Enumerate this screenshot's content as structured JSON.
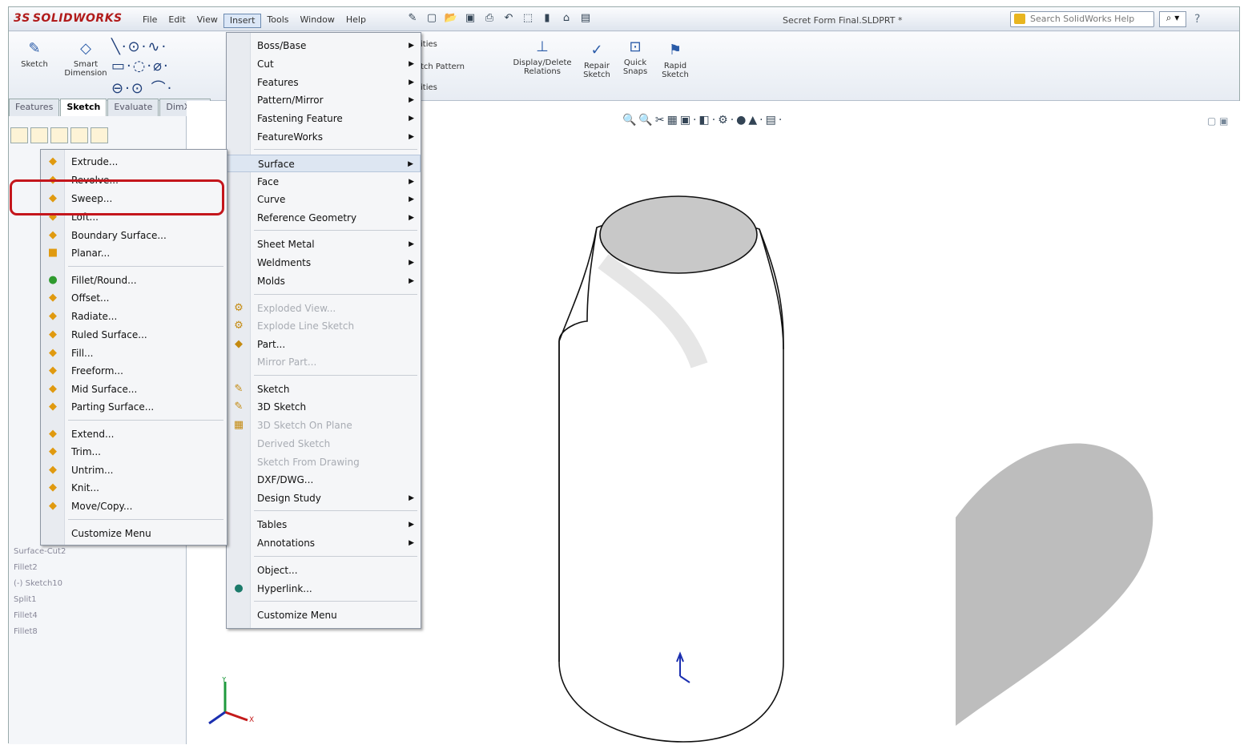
{
  "app": {
    "logo": "SOLIDWORKS",
    "logo_prefix": "3S",
    "document_title": "Secret Form Final.SLDPRT *"
  },
  "menubar": [
    "File",
    "Edit",
    "View",
    "Insert",
    "Tools",
    "Window",
    "Help"
  ],
  "search": {
    "placeholder": "Search SolidWorks Help",
    "button": "⌕ ▾"
  },
  "ribbon": {
    "sketch": "Sketch",
    "smart_dimension_1": "Smart",
    "smart_dimension_2": "Dimension",
    "entities": "ities",
    "sketch_pattern": "tch Pattern",
    "display_delete_1": "Display/Delete",
    "display_delete_2": "Relations",
    "repair_1": "Repair",
    "repair_2": "Sketch",
    "quick_1": "Quick",
    "quick_2": "Snaps",
    "rapid_1": "Rapid",
    "rapid_2": "Sketch",
    "ities": "ities"
  },
  "tabs": [
    "Features",
    "Sketch",
    "Evaluate",
    "DimXper"
  ],
  "tree": [
    "Surface-Cut2",
    "Fillet2",
    "(-) Sketch10",
    "Split1",
    "Fillet4",
    "Fillet8"
  ],
  "insert_menu": [
    {
      "label": "Boss/Base",
      "sub": true
    },
    {
      "label": "Cut",
      "sub": true
    },
    {
      "label": "Features",
      "sub": true
    },
    {
      "label": "Pattern/Mirror",
      "sub": true
    },
    {
      "label": "Fastening Feature",
      "sub": true
    },
    {
      "label": "FeatureWorks",
      "sub": true
    },
    {
      "label": "Surface",
      "sub": true
    },
    {
      "label": "Face",
      "sub": true
    },
    {
      "label": "Curve",
      "sub": true
    },
    {
      "label": "Reference Geometry",
      "sub": true
    },
    {
      "label": "Sheet Metal",
      "sub": true
    },
    {
      "label": "Weldments",
      "sub": true
    },
    {
      "label": "Molds",
      "sub": true
    },
    {
      "label": "Exploded View...",
      "disabled": true
    },
    {
      "label": "Explode Line Sketch",
      "disabled": true
    },
    {
      "label": "Part..."
    },
    {
      "label": "Mirror Part...",
      "disabled": true
    },
    {
      "label": "Sketch"
    },
    {
      "label": "3D Sketch"
    },
    {
      "label": "3D Sketch On Plane",
      "disabled": true
    },
    {
      "label": "Derived Sketch",
      "disabled": true
    },
    {
      "label": "Sketch From Drawing",
      "disabled": true
    },
    {
      "label": "DXF/DWG..."
    },
    {
      "label": "Design Study",
      "sub": true
    },
    {
      "label": "Tables",
      "sub": true
    },
    {
      "label": "Annotations",
      "sub": true
    },
    {
      "label": "Object..."
    },
    {
      "label": "Hyperlink..."
    },
    {
      "label": "Customize Menu"
    }
  ],
  "surface_menu": [
    "Extrude...",
    "Revolve...",
    "Sweep...",
    "Loft...",
    "Boundary Surface...",
    "Planar...",
    "Fillet/Round...",
    "Offset...",
    "Radiate...",
    "Ruled Surface...",
    "Fill...",
    "Freeform...",
    "Mid Surface...",
    "Parting Surface...",
    "Extend...",
    "Trim...",
    "Untrim...",
    "Knit...",
    "Move/Copy...",
    "Customize Menu"
  ],
  "axis": {
    "y": "Y",
    "x": "X"
  },
  "colors": {
    "callout": "#c4161c",
    "top_face": "#c8c8c8",
    "shadow": "#bdbdbd"
  }
}
